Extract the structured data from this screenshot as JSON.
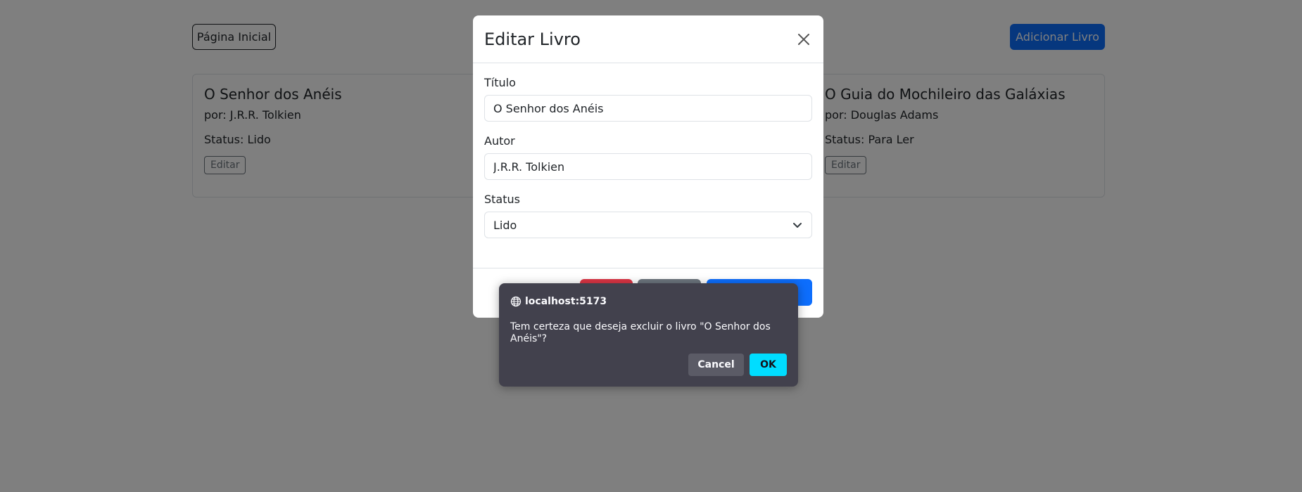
{
  "page": {
    "home_button": "Página Inicial",
    "add_button": "Adicionar Livro",
    "books": [
      {
        "title": "O Senhor dos Anéis",
        "author": "por: J.R.R. Tolkien",
        "status": "Status: Lido",
        "edit_label": "Editar"
      },
      {
        "title": "O Guia do Mochileiro das Galáxias",
        "author": "por: Douglas Adams",
        "status": "Status: Para Ler",
        "edit_label": "Editar"
      }
    ]
  },
  "modal": {
    "title": "Editar Livro",
    "fields": {
      "title_label": "Título",
      "title_value": "O Senhor dos Anéis",
      "author_label": "Autor",
      "author_value": "J.R.R. Tolkien",
      "status_label": "Status",
      "status_value": "Lido"
    }
  },
  "dialog": {
    "origin": "localhost:5173",
    "message": "Tem certeza que deseja excluir o livro \"O Senhor dos Anéis\"?",
    "cancel_label": "Cancel",
    "ok_label": "OK"
  },
  "colors": {
    "primary": "#0d6efd",
    "danger": "#dc3545",
    "secondary": "#6c757d",
    "dialog_bg": "#42414d",
    "dialog_ok": "#00ddff"
  }
}
